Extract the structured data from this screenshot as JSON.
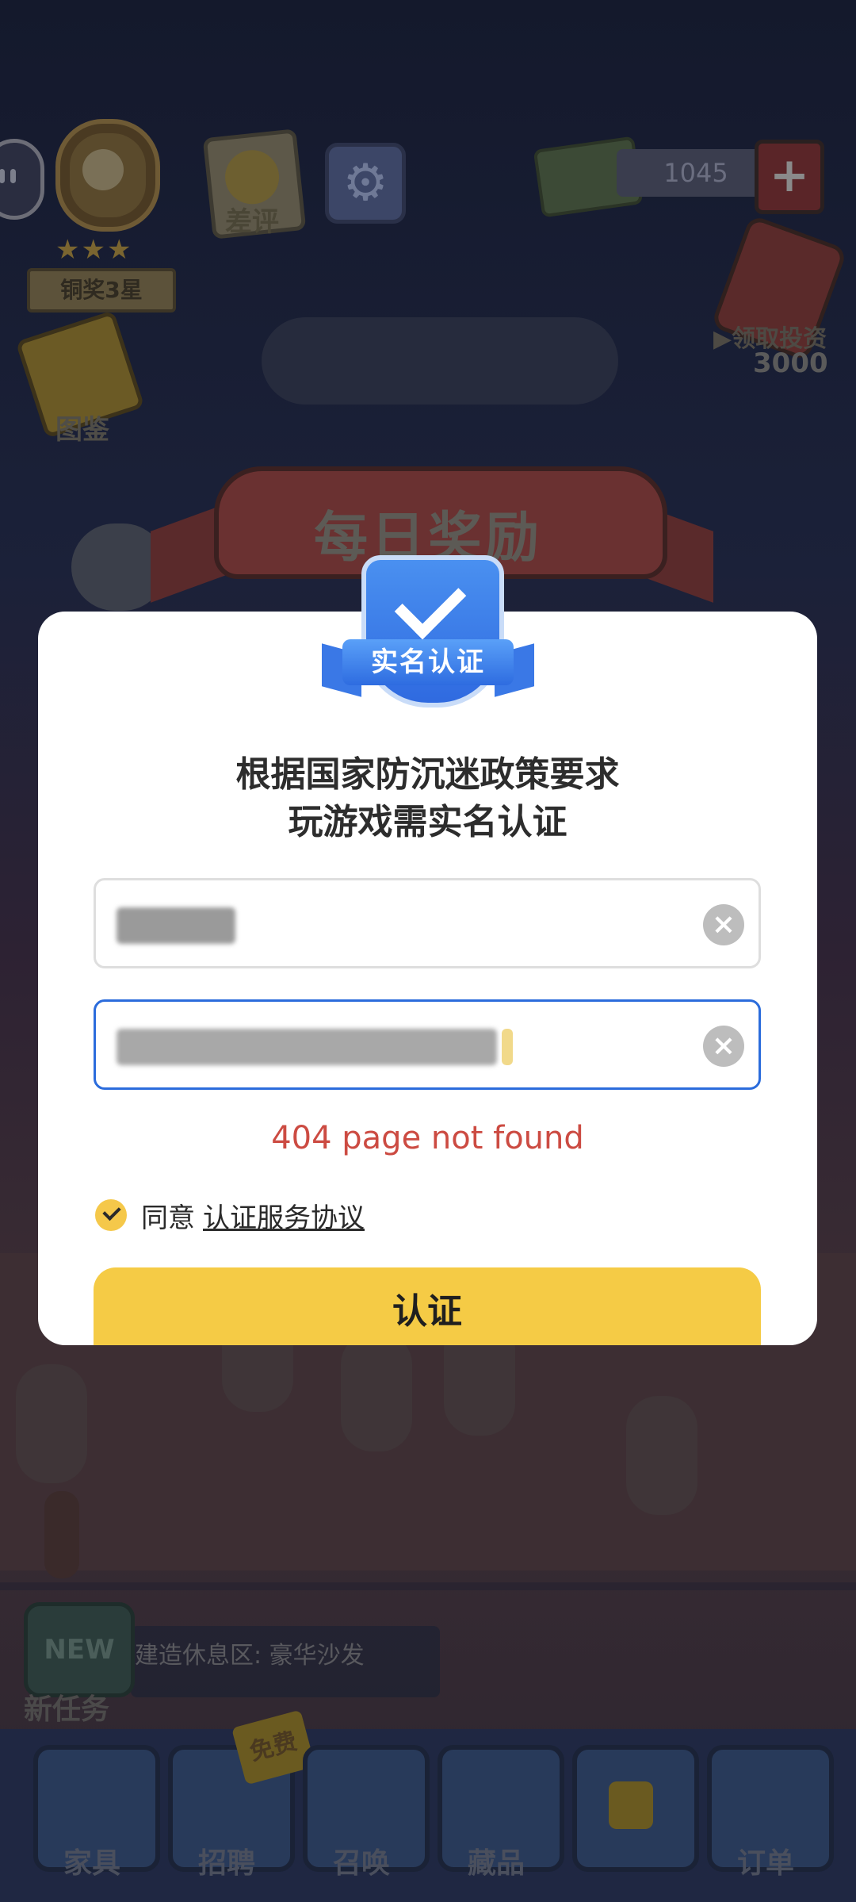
{
  "hud": {
    "rank_label": "铜奖3星",
    "review_label": "差评",
    "money_amount": "1045",
    "invest_label": "▶领取投资",
    "invest_amount": "3000",
    "book_label": "图鉴",
    "stars": "★★★"
  },
  "banner": {
    "title": "每日奖励"
  },
  "task": {
    "new_badge": "NEW",
    "label": "新任务",
    "text": "建造休息区: 豪华沙发"
  },
  "bottom_menu": {
    "items": [
      {
        "label": "家具"
      },
      {
        "label": "招聘"
      },
      {
        "label": "召唤"
      },
      {
        "label": "藏品"
      },
      {
        "label": ""
      },
      {
        "label": "订单"
      }
    ],
    "free_tag": "免费"
  },
  "modal": {
    "badge_text": "实名认证",
    "policy_line1": "根据国家防沉迷政策要求",
    "policy_line2": "玩游戏需实名认证",
    "name_field": {
      "clear_icon": "clear-icon"
    },
    "id_field": {
      "clear_icon": "clear-icon"
    },
    "error_text": "404 page not found",
    "agree_text": "同意",
    "agreement_link": "认证服务协议",
    "submit_label": "认证"
  },
  "colors": {
    "accent_yellow": "#f5cb45",
    "focus_blue": "#2b6cdc",
    "error_red": "#cc4b42"
  }
}
